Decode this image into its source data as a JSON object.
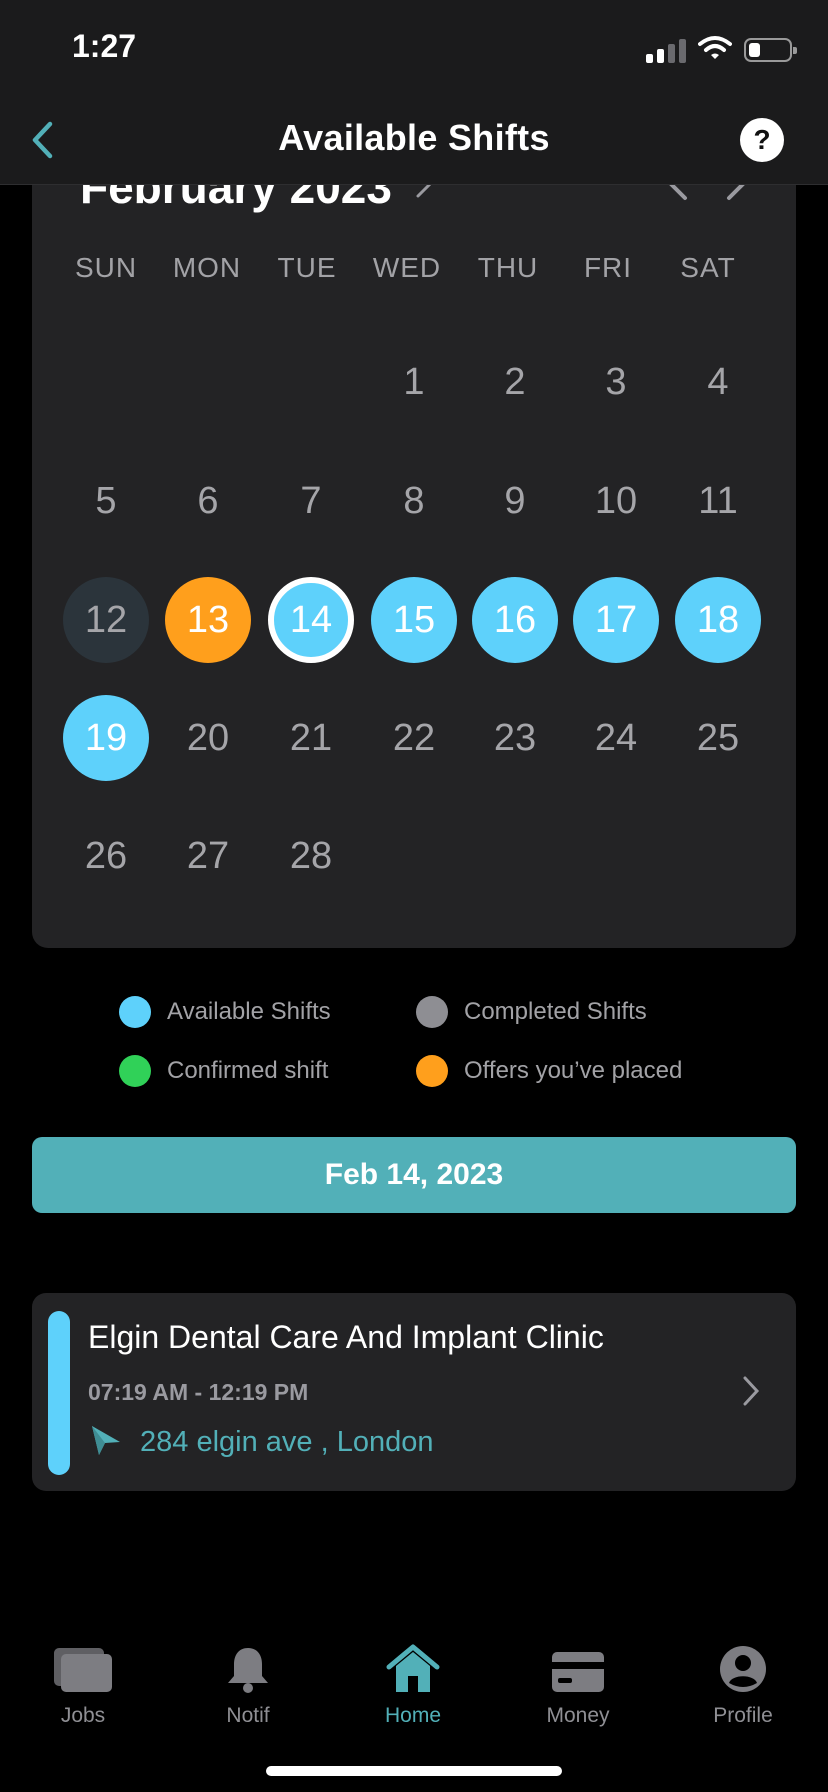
{
  "status_bar": {
    "time": "1:27"
  },
  "header": {
    "title": "Available Shifts",
    "help_label": "?"
  },
  "calendar": {
    "month_label": "February 2023",
    "weekdays": [
      "SUN",
      "MON",
      "TUE",
      "WED",
      "THU",
      "FRI",
      "SAT"
    ],
    "days": {
      "d1": "1",
      "d2": "2",
      "d3": "3",
      "d4": "4",
      "d5": "5",
      "d6": "6",
      "d7": "7",
      "d8": "8",
      "d9": "9",
      "d10": "10",
      "d11": "11",
      "d12": "12",
      "d13": "13",
      "d14": "14",
      "d15": "15",
      "d16": "16",
      "d17": "17",
      "d18": "18",
      "d19": "19",
      "d20": "20",
      "d21": "21",
      "d22": "22",
      "d23": "23",
      "d24": "24",
      "d25": "25",
      "d26": "26",
      "d27": "27",
      "d28": "28"
    },
    "available_days": [
      14,
      15,
      16,
      17,
      18,
      19
    ],
    "offer_days": [
      13
    ],
    "today": 12,
    "selected_day": 14
  },
  "legend": {
    "available": "Available Shifts",
    "completed": "Completed Shifts",
    "confirmed": "Confirmed shift",
    "offers": "Offers you’ve placed"
  },
  "selected_date_label": "Feb 14, 2023",
  "shift": {
    "title": "Elgin Dental Care And Implant Clinic",
    "time": "07:19 AM - 12:19 PM",
    "address": "284 elgin ave , London"
  },
  "tab_bar": {
    "jobs": "Jobs",
    "notif": "Notif",
    "home": "Home",
    "money": "Money",
    "profile": "Profile",
    "active": "Home"
  },
  "colors": {
    "available": "#5ED1FB",
    "completed": "#8E8E93",
    "confirmed": "#30D158",
    "offers": "#FF9F1C",
    "accent_teal": "#52B0B8",
    "card_background": "#232325"
  },
  "icons": {
    "back": "chevron-left-icon",
    "help": "question-mark-icon",
    "address": "location-arrow-icon",
    "jobs": "briefcase-icon",
    "notif": "bell-icon",
    "home": "house-icon",
    "money": "credit-card-icon",
    "profile": "person-icon"
  }
}
